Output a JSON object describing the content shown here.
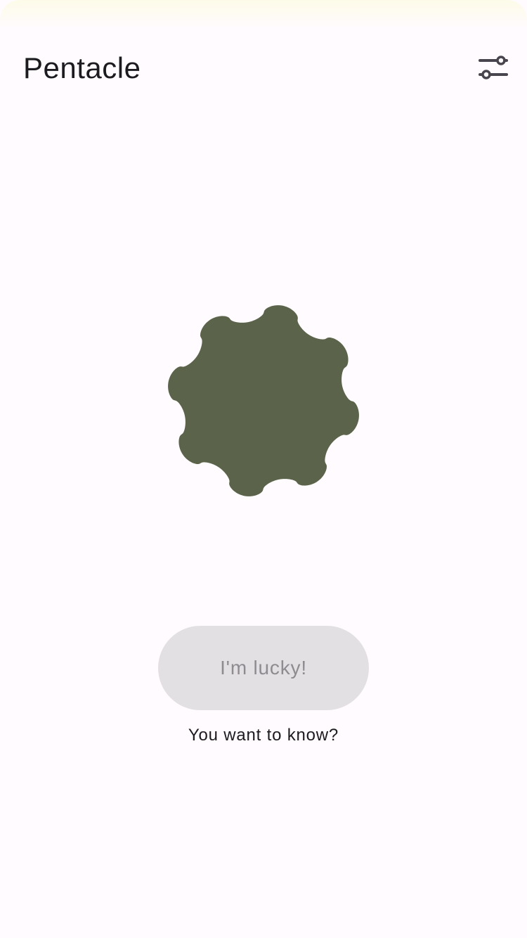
{
  "app": {
    "title": "Pentacle"
  },
  "toolbar": {
    "settings_icon": "tune-icon"
  },
  "main": {
    "shape_color": "#5b644b",
    "lucky_button_label": "I'm lucky!",
    "hint": "You want to know?"
  },
  "colors": {
    "background": "#fffbfe",
    "button_bg": "#e2e0e2",
    "button_text": "#8f8c91",
    "text": "#1c1b1f",
    "icon": "#49454f"
  }
}
